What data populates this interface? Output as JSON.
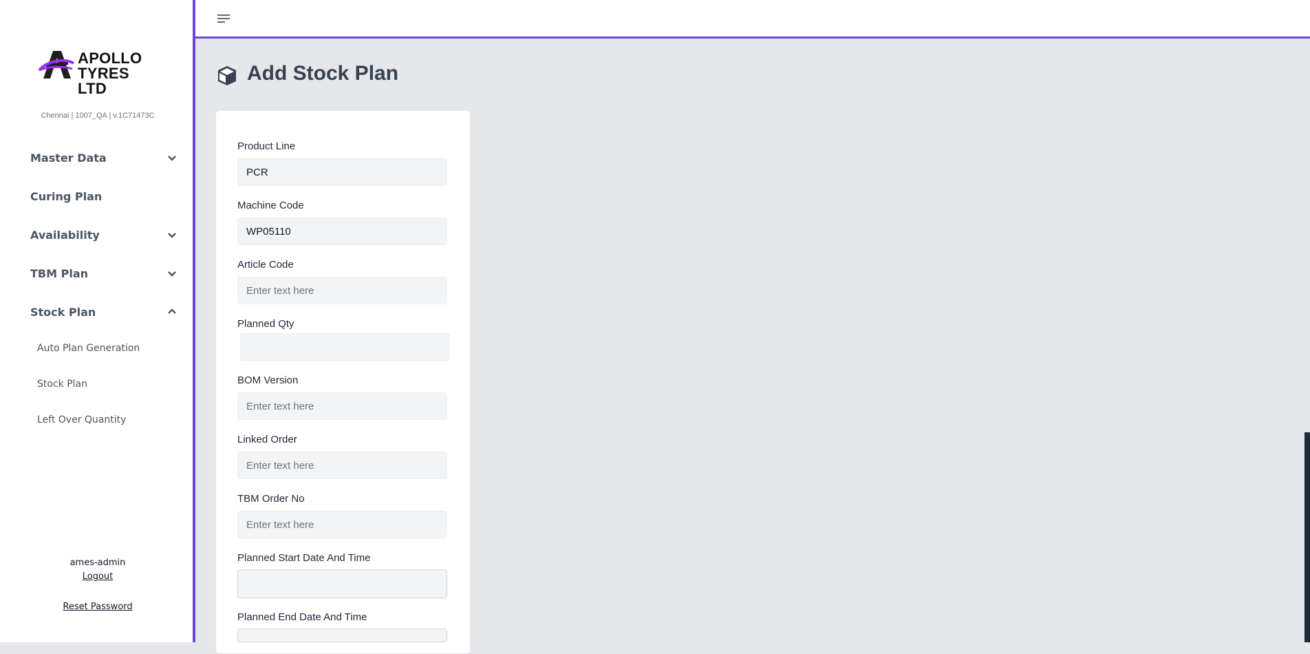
{
  "brand": {
    "line1": "APOLLO",
    "line2": "TYRES LTD"
  },
  "environment": "Chennai | 1007_QA | v.1C71473C",
  "nav": [
    {
      "label": "Master Data",
      "chevron": "chevron-down-icon"
    },
    {
      "label": "Curing Plan",
      "chevron": ""
    },
    {
      "label": "Availability",
      "chevron": "chevron-down-icon"
    },
    {
      "label": "TBM Plan",
      "chevron": "chevron-down-icon"
    },
    {
      "label": "Stock Plan",
      "chevron": "chevron-up-icon"
    }
  ],
  "stock_plan_sub": [
    "Auto Plan Generation",
    "Stock Plan",
    "Left Over Quantity"
  ],
  "user": {
    "name": "ames-admin",
    "logout": "Logout",
    "reset": "Reset Password"
  },
  "page": {
    "title": "Add Stock Plan",
    "icon": "cube-icon"
  },
  "form": {
    "product_line": {
      "label": "Product Line",
      "value": "PCR",
      "placeholder": ""
    },
    "machine_code": {
      "label": "Machine Code",
      "value": "WP05110",
      "placeholder": ""
    },
    "article_code": {
      "label": "Article Code",
      "value": "",
      "placeholder": "Enter text here"
    },
    "planned_qty": {
      "label": "Planned Qty",
      "value": "",
      "placeholder": ""
    },
    "bom_version": {
      "label": "BOM Version",
      "value": "",
      "placeholder": "Enter text here"
    },
    "linked_order": {
      "label": "Linked Order",
      "value": "",
      "placeholder": "Enter text here"
    },
    "tbm_order_no": {
      "label": "TBM Order No",
      "value": "",
      "placeholder": "Enter text here"
    },
    "planned_start": {
      "label": "Planned Start Date And Time",
      "value": "",
      "placeholder": ""
    },
    "planned_end": {
      "label": "Planned End Date And Time",
      "value": "",
      "placeholder": ""
    }
  },
  "colors": {
    "accent": "#6d44dc",
    "background": "#e5e7eb",
    "text": "#374151"
  }
}
